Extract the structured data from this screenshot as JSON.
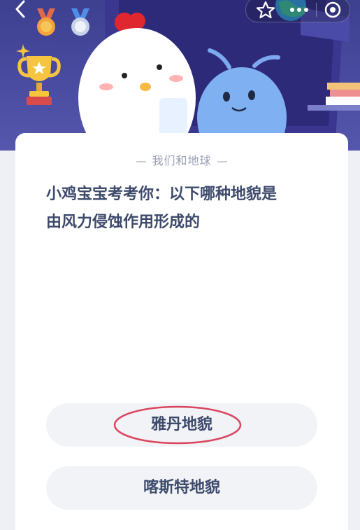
{
  "header": {
    "medal_gold_icon": "medal-gold-icon",
    "medal_silver_icon": "medal-silver-icon",
    "trophy_icon": "trophy-icon"
  },
  "nav": {
    "back_icon": "chevron-left-icon",
    "favorite_icon": "star-outline-icon",
    "more_icon": "more-dots-icon",
    "close_icon": "target-circle-icon"
  },
  "card": {
    "section_title": "我们和地球",
    "question_lines": [
      "小鸡宝宝考考你：以下哪种地貌是",
      "由风力侵蚀作用形成的"
    ]
  },
  "options": [
    {
      "label": "雅丹地貌",
      "highlighted": true
    },
    {
      "label": "喀斯特地貌",
      "highlighted": false
    }
  ],
  "colors": {
    "header_bg": "#3d3f8f",
    "text": "#3d4a6b",
    "option_bg": "#f2f3f7",
    "highlight_ring": "#d9475f"
  }
}
